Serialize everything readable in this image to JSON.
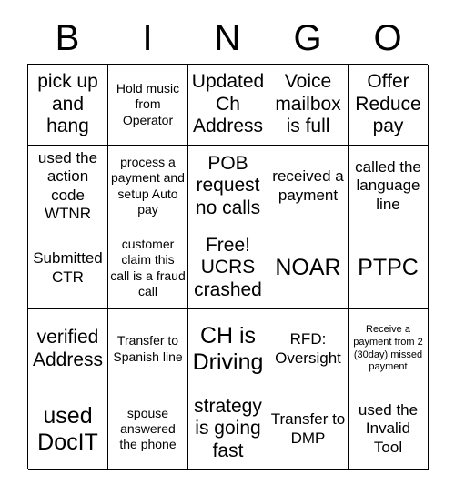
{
  "card": {
    "title_letters": [
      "B",
      "I",
      "N",
      "G",
      "O"
    ],
    "rows": [
      [
        {
          "text": "pick up and hang",
          "size": "lg"
        },
        {
          "text": "Hold music from Operator",
          "size": "sm"
        },
        {
          "text": "Updated Ch Address",
          "size": "lg"
        },
        {
          "text": "Voice mailbox is full",
          "size": "lg"
        },
        {
          "text": "Offer Reduce pay",
          "size": "lg"
        }
      ],
      [
        {
          "text": "used the action code WTNR",
          "size": "md"
        },
        {
          "text": "process a payment and setup Auto pay",
          "size": "sm"
        },
        {
          "text": "POB request no calls",
          "size": "lg"
        },
        {
          "text": "received a payment",
          "size": "md"
        },
        {
          "text": "called the language line",
          "size": "md"
        }
      ],
      [
        {
          "text": "Submitted CTR",
          "size": "md"
        },
        {
          "text": "customer claim this call is a fraud call",
          "size": "sm"
        },
        {
          "text": "Free! UCRS crashed",
          "size": "lg"
        },
        {
          "text": "NOAR",
          "size": "xl"
        },
        {
          "text": "PTPC",
          "size": "xl"
        }
      ],
      [
        {
          "text": "verified Address",
          "size": "lg"
        },
        {
          "text": "Transfer to Spanish line",
          "size": "sm"
        },
        {
          "text": "CH is Driving",
          "size": "xl"
        },
        {
          "text": "RFD: Oversight",
          "size": "md"
        },
        {
          "text": "Receive a payment from 2 (30day) missed payment",
          "size": "xs"
        }
      ],
      [
        {
          "text": "used DocIT",
          "size": "xl"
        },
        {
          "text": "spouse answered the phone",
          "size": "sm"
        },
        {
          "text": "strategy is going fast",
          "size": "lg"
        },
        {
          "text": "Transfer to DMP",
          "size": "md"
        },
        {
          "text": "used the Invalid Tool",
          "size": "md"
        }
      ]
    ]
  }
}
